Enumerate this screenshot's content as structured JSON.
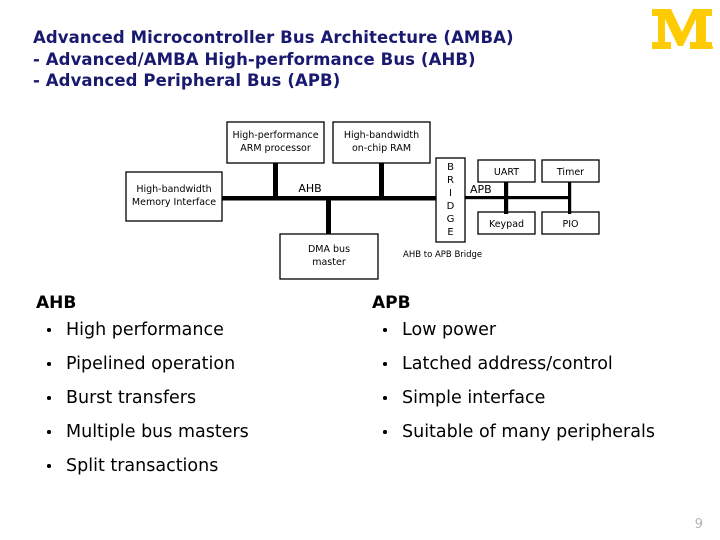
{
  "logo": {
    "name": "university-of-michigan-m-logo",
    "letter": "M",
    "color": "#FFCB05"
  },
  "title": {
    "color": "#191970",
    "lines": [
      "Advanced Microcontroller Bus Architecture (AMBA)",
      "- Advanced/AMBA High-performance Bus (AHB)",
      "- Advanced Peripheral Bus (APB)"
    ]
  },
  "diagram": {
    "bus_labels": {
      "ahb": "AHB",
      "apb": "APB"
    },
    "caption": "AHB to APB Bridge",
    "bridge": {
      "label": "BRIDGE",
      "letters": [
        "B",
        "R",
        "I",
        "D",
        "G",
        "E"
      ]
    },
    "boxes": [
      {
        "id": "arm-processor",
        "lines": [
          "High-performance",
          "ARM processor"
        ]
      },
      {
        "id": "on-chip-ram",
        "lines": [
          "High-bandwidth",
          "on-chip RAM"
        ]
      },
      {
        "id": "memory-interface",
        "lines": [
          "High-bandwidth",
          "Memory Interface"
        ]
      },
      {
        "id": "dma-bus-master",
        "lines": [
          "DMA bus",
          "master"
        ]
      },
      {
        "id": "uart",
        "lines": [
          "UART"
        ]
      },
      {
        "id": "timer",
        "lines": [
          "Timer"
        ]
      },
      {
        "id": "keypad",
        "lines": [
          "Keypad"
        ]
      },
      {
        "id": "pio",
        "lines": [
          "PIO"
        ]
      }
    ]
  },
  "columns": {
    "ahb": {
      "heading": "AHB",
      "items": [
        "High performance",
        "Pipelined operation",
        "Burst transfers",
        "Multiple bus masters",
        "Split transactions"
      ]
    },
    "apb": {
      "heading": "APB",
      "items": [
        "Low power",
        "Latched address/control",
        "Simple interface",
        "Suitable of many peripherals"
      ]
    }
  },
  "footer": {
    "page_number": "9"
  }
}
